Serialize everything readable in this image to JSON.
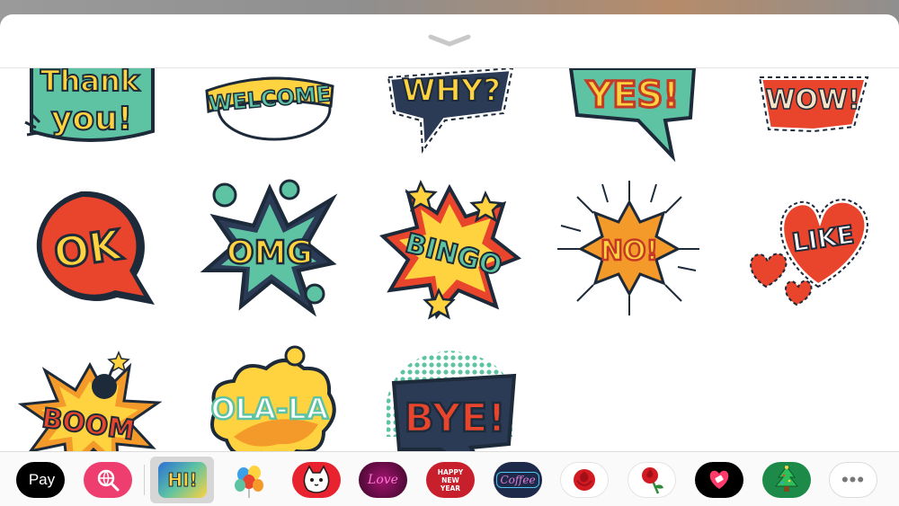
{
  "header": {
    "collapse_icon": "chevron-down-icon"
  },
  "stickers": [
    {
      "id": "thank-you",
      "lines": [
        "Thank",
        "you!"
      ]
    },
    {
      "id": "welcome",
      "lines": [
        "WELCOME"
      ]
    },
    {
      "id": "why",
      "lines": [
        "WHY?"
      ]
    },
    {
      "id": "yes",
      "lines": [
        "YES!"
      ]
    },
    {
      "id": "wow",
      "lines": [
        "WOW!"
      ]
    },
    {
      "id": "ok",
      "lines": [
        "OK"
      ]
    },
    {
      "id": "omg",
      "lines": [
        "OMG"
      ]
    },
    {
      "id": "bingo",
      "lines": [
        "BINGO"
      ]
    },
    {
      "id": "no",
      "lines": [
        "NO!"
      ]
    },
    {
      "id": "like",
      "lines": [
        "LIKE"
      ]
    },
    {
      "id": "boom",
      "lines": [
        "BOOM"
      ]
    },
    {
      "id": "ola-la",
      "lines": [
        "OLA-LA"
      ]
    },
    {
      "id": "bye",
      "lines": [
        "BYE!"
      ]
    }
  ],
  "app_tray": {
    "apple_pay": {
      "glyph": "",
      "label": "Pay"
    },
    "apps": [
      {
        "name": "web-search-app",
        "icon": "globe-search-icon",
        "color": "#ee3d6f"
      },
      {
        "name": "hi-stickers-app",
        "label": "HI!",
        "selected": true,
        "color": "#2a6fd6"
      },
      {
        "name": "balloons-app",
        "icon": "balloons-icon"
      },
      {
        "name": "cat-stickers-app",
        "icon": "cat-icon",
        "color": "#e8232f"
      },
      {
        "name": "love-neon-app",
        "label": "Love",
        "color": "#a0146e"
      },
      {
        "name": "happy-new-year-app",
        "label": "HAPPY NEW YEAR",
        "color": "#c71f2b"
      },
      {
        "name": "coffee-neon-app",
        "label": "Coffee",
        "color": "#1d2a4a"
      },
      {
        "name": "rose-app",
        "icon": "rose-icon"
      },
      {
        "name": "rose-stem-app",
        "icon": "rose-stem-icon"
      },
      {
        "name": "heart-app",
        "icon": "heart-icon",
        "color": "#000000"
      },
      {
        "name": "christmas-app",
        "icon": "christmas-tree-icon",
        "color": "#1d8a4a"
      },
      {
        "name": "more-apps",
        "label": "•••"
      }
    ]
  },
  "colors": {
    "yellow": "#ffd23f",
    "red": "#e8452c",
    "teal": "#5ec3a3",
    "navy": "#2b3a55",
    "orange": "#f49a2a"
  }
}
